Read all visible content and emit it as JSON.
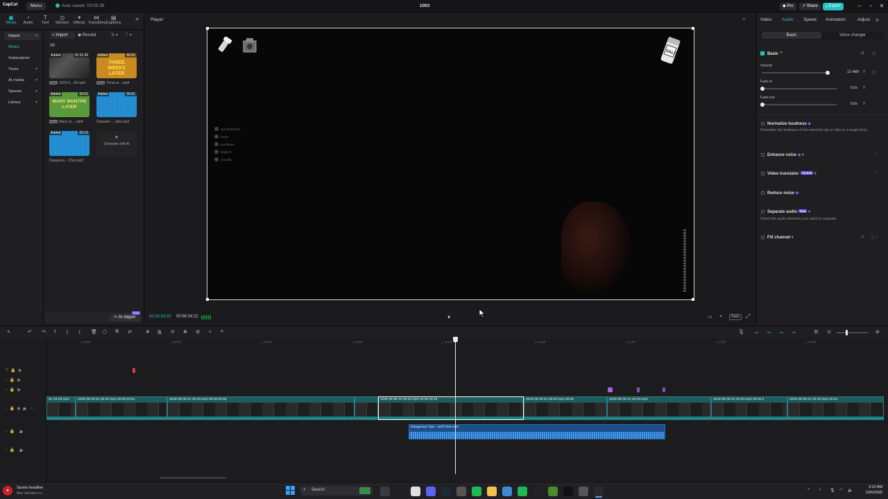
{
  "app": {
    "logo": "CapCut",
    "menu_label": "Menu",
    "autosave_text": "Auto saved: 03:05:38",
    "project_title": "1003",
    "pro_label": "Pro",
    "share_label": "Share",
    "export_label": "Export",
    "accent_color": "#22c1c3"
  },
  "left_panel": {
    "tool_tabs": [
      {
        "label": "Media",
        "icon": "media-icon"
      },
      {
        "label": "Audio",
        "icon": "audio-icon"
      },
      {
        "label": "Text",
        "icon": "text-icon"
      },
      {
        "label": "Stickers",
        "icon": "stickers-icon"
      },
      {
        "label": "Effects",
        "icon": "effects-icon"
      },
      {
        "label": "Transitions",
        "icon": "transitions-icon"
      },
      {
        "label": "Captions",
        "icon": "captions-icon"
      }
    ],
    "side_items": [
      "Import",
      "Media",
      "Subprojects",
      "Yours",
      "AI media",
      "Spaces",
      "Library"
    ],
    "import_button": "Import",
    "record_button": "Record",
    "filter_all": "All",
    "media_items": [
      {
        "added": "Added",
        "duration": "01:11:30",
        "name": "2025-0....05.mp4",
        "proxy": "Proxy"
      },
      {
        "added": "Added",
        "duration": "00:02",
        "name": "Three w....mp4",
        "proxy": "Proxy",
        "thumb_text": "THREE WEEKS LATER"
      },
      {
        "added": "Added",
        "duration": "00:02",
        "name": "Many m.....mp4",
        "proxy": "Proxy",
        "thumb_text": "MANY MONTHS LATER"
      },
      {
        "added": "Added",
        "duration": "00:01",
        "name": "Osmosin -...xble.mp3"
      },
      {
        "added": "Added",
        "duration": "03:10",
        "name": "Dangerou....Chol.mp3"
      }
    ],
    "generate_label": "Generate with AI",
    "ai_clipper_label": "AI clipper",
    "ai_clipper_badge": "Free"
  },
  "player": {
    "title": "Player",
    "current_time": "00:10:03:20",
    "total_time": "00:56:34:22",
    "ratio_label": "Ratio",
    "chat_lines": [
      "spoofterflower",
      "hoola",
      "goodmaw",
      "Bright ll",
      "choodle"
    ]
  },
  "right_panel": {
    "tabs": [
      "Video",
      "Audio",
      "Speed",
      "Animation",
      "Adjust"
    ],
    "active_tab": "Audio",
    "subtabs": [
      "Basic",
      "Voice changer"
    ],
    "basic_label": "Basic",
    "volume_label": "Volume",
    "volume_value": "12.4dB",
    "fade_in_label": "Fade in",
    "fade_in_value": "0.0s",
    "fade_out_label": "Fade out",
    "fade_out_value": "0.0s",
    "normalize_label": "Normalize loudness",
    "normalize_desc": "Normalize the loudness of the selected clip or clips to a target level.",
    "enhance_label": "Enhance voice",
    "translator_label": "Video translator",
    "translator_badge": "Try free",
    "reduce_noise_label": "Reduce noise",
    "separate_label": "Separate audio",
    "separate_badge": "Free",
    "separate_desc": "Select the audio elements you want to separate.",
    "fill_channel_label": "Fill channel"
  },
  "timeline": {
    "ruler": [
      "00:00",
      "00:00",
      "00:00",
      "00:30",
      "00:00",
      "10:00",
      "10:30",
      "11:00",
      "11:30",
      "12:00"
    ],
    "clips": [
      {
        "label": "01-48-03.mp4"
      },
      {
        "label": "2025-06-08 01-48-03.mp4  00:00:29:51"
      },
      {
        "label": "2025-06-08 01-48-03.mp4  00:00:50:55"
      },
      {
        "label": "2025-06-08 01-48-03.mp4  00:00:48:18"
      },
      {
        "label": "2025-06-08 01-48-03.mp4  00:00"
      },
      {
        "label": "2025-06-08 01-48-03.mp4"
      },
      {
        "label": "2025-06-08 01-48-03.mp4  00:02:3"
      },
      {
        "label": "2025-06-08 01-48-03.mp4  00:44"
      }
    ],
    "audio_clip_label": "Dangerous Toys - Self Chol.mp3"
  },
  "taskbar": {
    "news_title": "Sports headline",
    "news_sub": "Max Johnson re...",
    "search_label": "Search",
    "time": "3:10 AM",
    "date": "10/5/2025"
  }
}
